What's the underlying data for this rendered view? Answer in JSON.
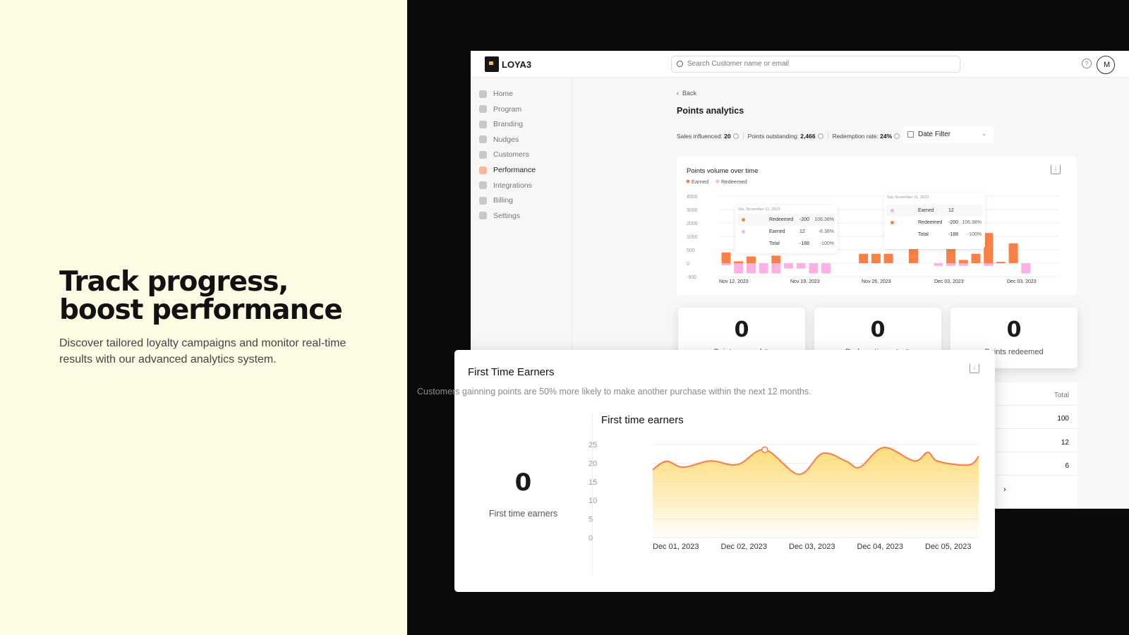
{
  "hero": {
    "title_line1": "Track progress,",
    "title_line2": "boost performance",
    "description": "Discover tailored loyalty campaigns and monitor real-time results with our advanced analytics system."
  },
  "header": {
    "brand": "LOYA3",
    "search_placeholder": "Search Customer name or email",
    "help": "?",
    "avatar": "M"
  },
  "sidebar": {
    "items": [
      {
        "label": "Home",
        "icon": "home-icon"
      },
      {
        "label": "Program",
        "icon": "star-icon"
      },
      {
        "label": "Branding",
        "icon": "globe-icon"
      },
      {
        "label": "Nudges",
        "icon": "nudge-icon"
      },
      {
        "label": "Customers",
        "icon": "face-icon"
      },
      {
        "label": "Performance",
        "icon": "pulse-icon",
        "active": true
      },
      {
        "label": "Integrations",
        "icon": "grid-icon"
      },
      {
        "label": "Billing",
        "icon": "document-icon"
      },
      {
        "label": "Settings",
        "icon": "gear-icon"
      }
    ]
  },
  "page": {
    "back": "Back",
    "title": "Points analytics",
    "stats": [
      {
        "label": "Sales influenced:",
        "value": "20"
      },
      {
        "label": "Points outstanding:",
        "value": "2,466"
      },
      {
        "label": "Redemption rate:",
        "value": "24%"
      }
    ],
    "date_filter": "Date Filter"
  },
  "colors": {
    "earned": "#fb8047",
    "redeemed": "#fbb1e4",
    "line": "#fb7a4a",
    "area": "#fdd86a"
  },
  "kpis": [
    {
      "value": "0",
      "label": "Points earned"
    },
    {
      "value": "0",
      "label": "Redemption rate"
    },
    {
      "value": "0",
      "label": "Points redeemed"
    }
  ],
  "table": {
    "header": "Total",
    "rows": [
      "100",
      "12",
      "6"
    ],
    "next": "›"
  },
  "tooltips": [
    {
      "date": "Sat, November 11, 2023",
      "rows": [
        {
          "label": "Redeemed",
          "value": "-200",
          "pct": "106.38%"
        },
        {
          "label": "Earned",
          "value": "12",
          "pct": "-6.38%"
        },
        {
          "label": "Total",
          "value": "-188",
          "pct": "-100%"
        }
      ]
    },
    {
      "date": "Sat, November 11, 2023",
      "rows": [
        {
          "label": "Earned",
          "value": "12",
          "pct": ""
        },
        {
          "label": "Redeemed",
          "value": "-200",
          "pct": "106.38%"
        },
        {
          "label": "Total",
          "value": "-188",
          "pct": "-100%"
        }
      ]
    }
  ],
  "overlay": {
    "title": "First Time Earners",
    "subtitle": "Customers gainning points are 50% more likely to make another purchase within the next 12 months.",
    "kpi_value": "0",
    "kpi_label": "First time earners"
  },
  "chart_data": [
    {
      "type": "bar",
      "title": "Points volume over time",
      "legend": [
        "Earned",
        "Redeemed"
      ],
      "legend_placement": "top-left",
      "grid": true,
      "yticks": [
        -500,
        0,
        500,
        1000,
        2000,
        3000,
        4000
      ],
      "xticks": [
        "Nov 12, 2023",
        "Nov 19, 2023",
        "Nov 26, 2023",
        "Dec 03, 2023",
        "Dec 03, 2023"
      ],
      "series": [
        {
          "name": "Earned",
          "values": [
            400,
            70,
            250,
            0,
            280,
            0,
            0,
            0,
            0,
            0,
            0,
            350,
            350,
            350,
            0,
            700,
            0,
            0,
            680,
            120,
            350,
            1250,
            50,
            740,
            0
          ]
        },
        {
          "name": "Redeemed",
          "values": [
            -80,
            -380,
            -380,
            -380,
            -380,
            -200,
            -200,
            -380,
            -380,
            0,
            0,
            0,
            0,
            0,
            0,
            0,
            0,
            -100,
            -100,
            -100,
            0,
            -100,
            0,
            0,
            -380
          ]
        }
      ]
    },
    {
      "type": "area",
      "title": "First time earners",
      "ylim": [
        0,
        25
      ],
      "yticks": [
        0,
        5,
        10,
        15,
        20,
        25
      ],
      "grid": true,
      "xticks": [
        "Dec 01, 2023",
        "Dec 02, 2023",
        "Dec 03, 2023",
        "Dec 04, 2023",
        "Dec 05, 2023"
      ],
      "x": [
        "2023-12-01T00",
        "2023-12-01T04",
        "2023-12-01T09",
        "2023-12-01T17",
        "2023-12-02T01",
        "2023-12-02T09",
        "2023-12-02T19",
        "2023-12-03T02",
        "2023-12-03T09",
        "2023-12-03T13",
        "2023-12-03T20",
        "2023-12-04T05",
        "2023-12-04T09",
        "2023-12-04T12",
        "2023-12-04T21",
        "2023-12-05T00"
      ],
      "y": [
        18.2,
        20.5,
        18.9,
        20.6,
        19.6,
        23.6,
        17.0,
        22.6,
        20.5,
        18.9,
        24.2,
        20.6,
        22.9,
        20.5,
        19.5,
        21.8
      ],
      "highlight_index": 5
    }
  ]
}
